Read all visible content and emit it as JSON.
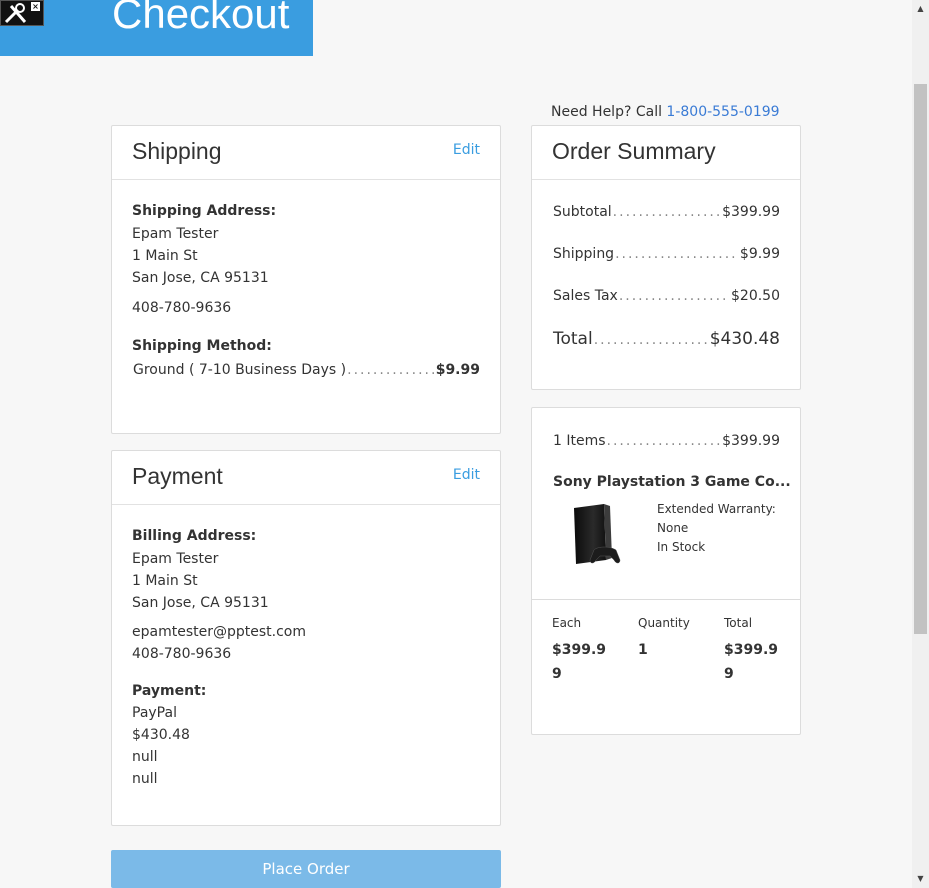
{
  "header": {
    "title": "Checkout"
  },
  "help": {
    "prefix": "Need Help? Call ",
    "phone": "1-800-555-0199"
  },
  "shipping": {
    "title": "Shipping",
    "edit_label": "Edit",
    "address_label": "Shipping Address:",
    "name": "Epam Tester",
    "street": "1 Main St",
    "city": "San Jose, CA 95131",
    "phone": "408-780-9636",
    "method_label": "Shipping Method:",
    "method": "Ground ( 7-10 Business Days )",
    "method_price": "$9.99"
  },
  "payment": {
    "title": "Payment",
    "edit_label": "Edit",
    "billing_label": "Billing Address:",
    "name": "Epam Tester",
    "street": "1 Main St",
    "city": "San Jose, CA 95131",
    "email": "epamtester@pptest.com",
    "phone": "408-780-9636",
    "payment_label": "Payment:",
    "method": "PayPal",
    "amount": "$430.48",
    "line1": "null",
    "line2": "null"
  },
  "summary": {
    "title": "Order Summary",
    "subtotal_label": "Subtotal",
    "subtotal": "$399.99",
    "shipping_label": "Shipping",
    "shipping": "$9.99",
    "tax_label": "Sales Tax",
    "tax": "$20.50",
    "total_label": "Total",
    "total": "$430.48"
  },
  "items": {
    "count_label": "1 Items",
    "count_total": "$399.99",
    "product_name": "Sony Playstation 3 Game Co...",
    "warranty_label": "Extended Warranty:",
    "warranty_value": "None",
    "stock": "In Stock",
    "each_label": "Each",
    "each_value": "$399.99",
    "qty_label": "Quantity",
    "qty_value": "1",
    "total_label": "Total",
    "total_value": "$399.99"
  },
  "actions": {
    "place_order": "Place Order"
  },
  "colors": {
    "brand": "#3a9de0",
    "button": "#7bbae8",
    "link": "#3a7bd5"
  }
}
